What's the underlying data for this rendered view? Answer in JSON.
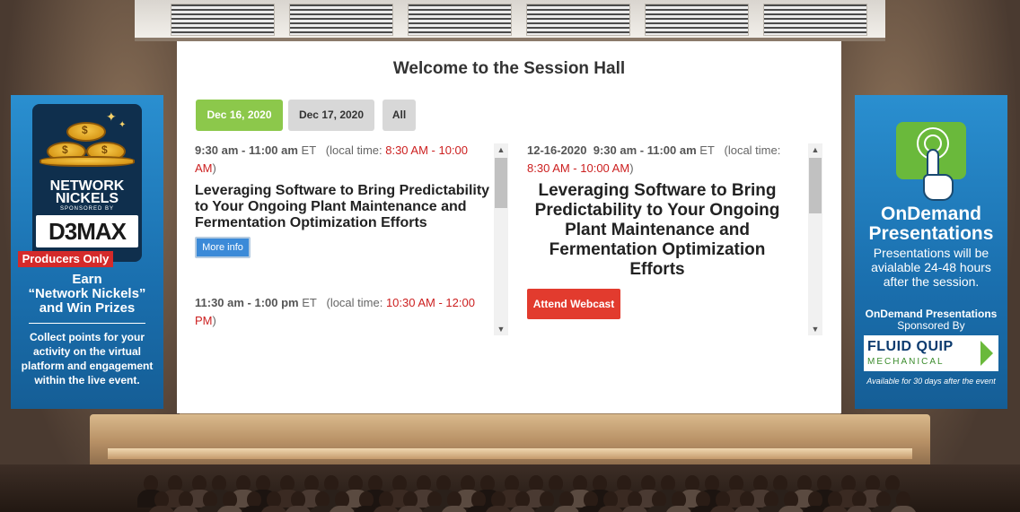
{
  "page": {
    "title": "Welcome to the Session Hall"
  },
  "tabs": [
    {
      "label": "Dec 16, 2020",
      "active": true
    },
    {
      "label": "Dec 17, 2020",
      "active": false
    },
    {
      "label": "All",
      "active": false
    }
  ],
  "left_column": {
    "sessions": [
      {
        "time": "9:30 am - 11:00 am",
        "tz": "ET",
        "local_prefix": "(local time: ",
        "local_time": "8:30 AM - 10:00 AM",
        "local_suffix": ")",
        "title": "Leveraging Software to Bring Predictability to Your Ongoing Plant Maintenance and Fermentation Optimization Efforts",
        "button": "More info"
      },
      {
        "time": "11:30 am - 1:00 pm",
        "tz": "ET",
        "local_prefix": "(local time: ",
        "local_time": "10:30 AM - 12:00 PM",
        "local_suffix": ")"
      }
    ]
  },
  "right_column": {
    "date": "12-16-2020",
    "time": "9:30 am - 11:00 am",
    "tz": "ET",
    "local_prefix": "(local time:",
    "local_time": "8:30 AM - 10:00 AM",
    "local_suffix": ")",
    "title": "Leveraging Software to Bring Predictability to Your Ongoing Plant Maintenance and Fermentation Optimization Efforts",
    "button": "Attend Webcast"
  },
  "left_banner": {
    "badge_line1": "NETWORK",
    "badge_line2": "NICKELS",
    "sponsored": "SPONSORED BY",
    "logo": "D3MAX",
    "producers": "Producers Only",
    "earn_line1": "Earn",
    "earn_line2": "“Network Nickels”",
    "earn_line3": "and Win Prizes",
    "collect": "Collect points for your activity on the virtual platform and engagement within the live event."
  },
  "right_banner": {
    "title_line1": "OnDemand",
    "title_line2": "Presentations",
    "subtitle": "Presentations will be avialable 24-48 hours after the session.",
    "sponsor_line": "OnDemand Presentations",
    "sponsor_by": "Sponsored By",
    "logo_name": "FLUID QUIP",
    "logo_sub": "MECHANICAL",
    "footer": "Available for 30 days after the event"
  },
  "icons": {
    "scroll_up": "triangle-up",
    "scroll_down": "triangle-down",
    "coins": "coin-stack",
    "touch": "hand-touch"
  },
  "colors": {
    "active_tab": "#8cc84b",
    "local_time": "#cc1f1f",
    "more_info": "#3b8ad8",
    "attend": "#e23b2e",
    "banner_blue": "#1a6fae"
  },
  "scroll": {
    "left_position": 0,
    "right_position": 0
  }
}
